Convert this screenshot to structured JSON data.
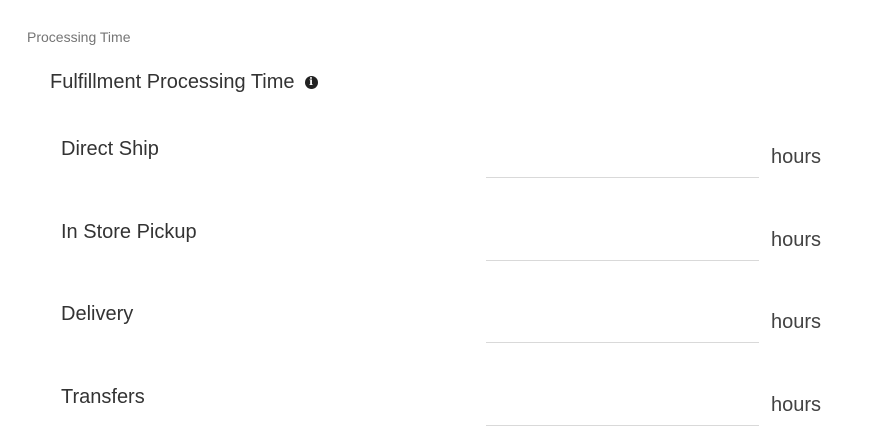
{
  "section": {
    "label": "Processing Time"
  },
  "group": {
    "title": "Fulfillment Processing Time",
    "info_icon": "info-icon",
    "info_glyph": "i"
  },
  "rows": [
    {
      "label": "Direct Ship",
      "value": "",
      "unit": "hours"
    },
    {
      "label": "In Store Pickup",
      "value": "",
      "unit": "hours"
    },
    {
      "label": "Delivery",
      "value": "",
      "unit": "hours"
    },
    {
      "label": "Transfers",
      "value": "",
      "unit": "hours"
    }
  ]
}
